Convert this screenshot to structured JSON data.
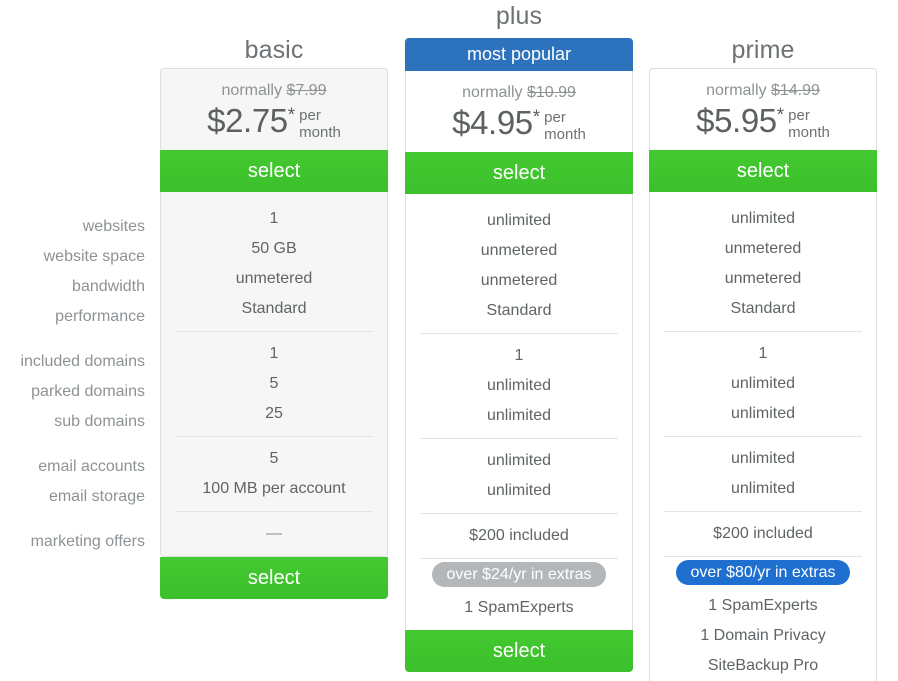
{
  "feature_labels": {
    "groups": [
      [
        "websites",
        "website space",
        "bandwidth",
        "performance"
      ],
      [
        "included domains",
        "parked domains",
        "sub domains"
      ],
      [
        "email accounts",
        "email storage"
      ],
      [
        "marketing offers"
      ]
    ]
  },
  "plans": {
    "basic": {
      "title": "basic",
      "normally_prefix": "normally",
      "normally_price": "$7.99",
      "price": "$2.75",
      "asterisk": "*",
      "per": "per",
      "month": "month",
      "select_label": "select",
      "select_label_bottom": "select",
      "features": {
        "groups": [
          [
            "1",
            "50 GB",
            "unmetered",
            "Standard"
          ],
          [
            "1",
            "5",
            "25"
          ],
          [
            "5",
            "100 MB per account"
          ],
          [
            "—"
          ]
        ]
      },
      "extras_pill": "",
      "extras_items": []
    },
    "plus": {
      "title": "plus",
      "ribbon_label": "most popular",
      "normally_prefix": "normally",
      "normally_price": "$10.99",
      "price": "$4.95",
      "asterisk": "*",
      "per": "per",
      "month": "month",
      "select_label": "select",
      "select_label_bottom": "select",
      "features": {
        "groups": [
          [
            "unlimited",
            "unmetered",
            "unmetered",
            "Standard"
          ],
          [
            "1",
            "unlimited",
            "unlimited"
          ],
          [
            "unlimited",
            "unlimited"
          ],
          [
            "$200 included"
          ]
        ]
      },
      "extras_pill": "over $24/yr in extras",
      "extras_items": [
        "1 SpamExperts"
      ]
    },
    "prime": {
      "title": "prime",
      "normally_prefix": "normally",
      "normally_price": "$14.99",
      "price": "$5.95",
      "asterisk": "*",
      "per": "per",
      "month": "month",
      "select_label": "select",
      "features": {
        "groups": [
          [
            "unlimited",
            "unmetered",
            "unmetered",
            "Standard"
          ],
          [
            "1",
            "unlimited",
            "unlimited"
          ],
          [
            "unlimited",
            "unlimited"
          ],
          [
            "$200 included"
          ]
        ]
      },
      "extras_pill": "over $80/yr in extras",
      "extras_items": [
        "1 SpamExperts",
        "1 Domain Privacy",
        "SiteBackup Pro"
      ]
    }
  },
  "colors": {
    "select_green": "#3fc52e",
    "ribbon_blue": "#2d72bc",
    "pill_blue": "#1f6fd0",
    "pill_gray": "#b4b7b9",
    "card_border": "#dcdedf",
    "basic_bg": "#f6f6f6",
    "text": "#5b6063",
    "muted_text": "#8d9295"
  }
}
